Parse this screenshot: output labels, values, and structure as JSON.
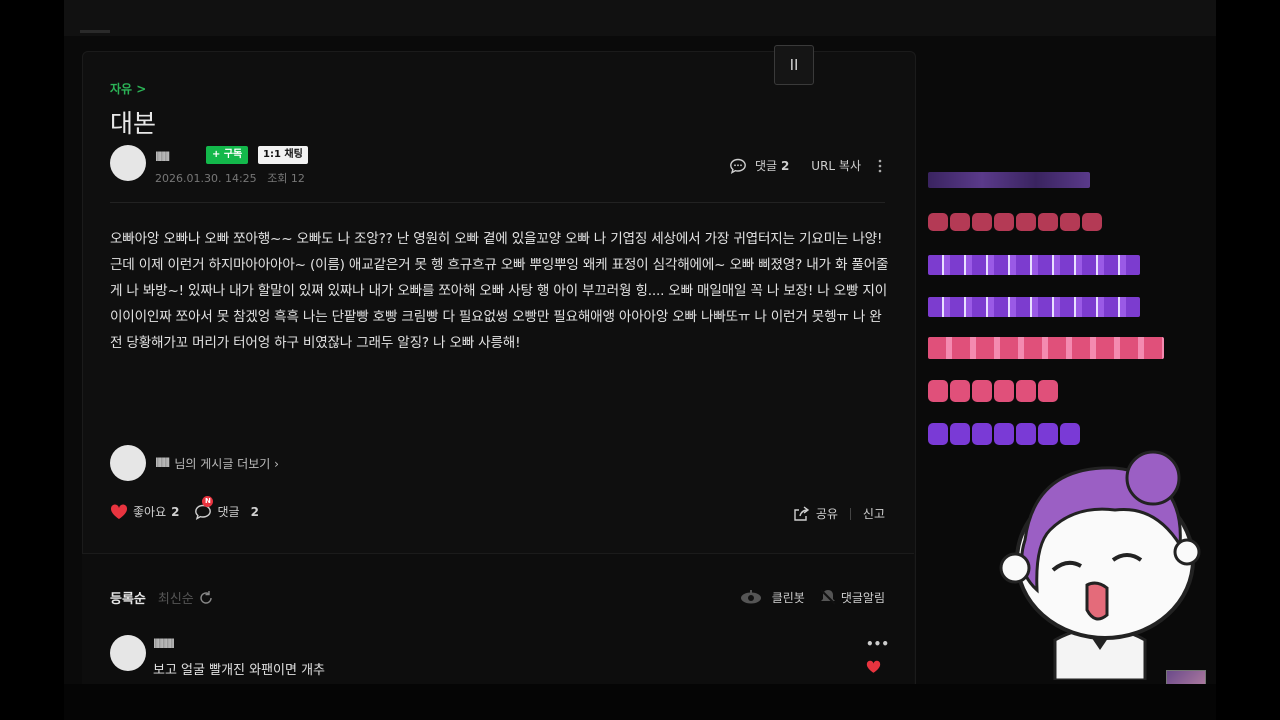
{
  "post": {
    "category": "자유 >",
    "title": "대본",
    "author": "llllllllll",
    "subscribe_label": "+ 구독",
    "chat_label": "1:1 채팅",
    "date": "2026.01.30. 14:25",
    "views": "조회 12",
    "comment_label": "댓글",
    "comment_count": "2",
    "url_copy_label": "URL 복사",
    "body": "오빠아앙 오빠나 오빠 쪼아행~~ 오빠도 나 조앙?? 난 영원히 오빠 곁에 있을꼬양 오빠 나 기엽징 세상에서 가장 귀엽터지는 기요미는 나양! 근데 이제 이런거 하지마아아아아~ (이름) 애교같은거 못 헹 흐규흐규 오빠 뿌잉뿌잉 왜케 표정이 심각해에에~ 오빠 삐졌영? 내가 화 풀어줄게 나 봐방~! 있짜나 내가 할말이 있쪄 있짜나 내가 오빠를 쪼아해 오빠 사탕 행 아이 부끄러웡 힝.... 오빠 매일매일 꼭 나 보장! 나 오빵 지이이이이인짜 쪼아서 못 참겠엉 흑흑 나는 단팥빵 호빵 크림빵 다 필요없썽 오빵만 필요해애앵 아아아앙 오빠 나빠또ㅠ 나 이런거 못헹ㅠ 나 완전 당황해가꼬 머리가 터어엉 하구 비였잖나 그래두 알징? 나 오빠 사릉해!",
    "more_author": "llllllllll",
    "more_label": "님의 게시글 더보기 ›",
    "like_label": "좋아요",
    "like_count": "2",
    "comment_badge": "N",
    "comment_label2": "댓글",
    "comment_count2": "2",
    "share_label": "공유",
    "report_label": "신고"
  },
  "comments": {
    "sort_active": "등록순",
    "sort_inactive": "최신순",
    "cleanbot_label": "클린봇",
    "notify_label": "댓글알림",
    "items": [
      {
        "author": "lllllllllllllll",
        "text": "보고 얼굴 빨개진 와팬이면 개추",
        "more": "•••"
      }
    ]
  },
  "player": {
    "pause_icon": "II"
  },
  "colors": {
    "accent_green": "#2bb356",
    "subscribe_green": "#13b84b",
    "heart_red": "#e8343f",
    "background": "#0f0f0f"
  }
}
